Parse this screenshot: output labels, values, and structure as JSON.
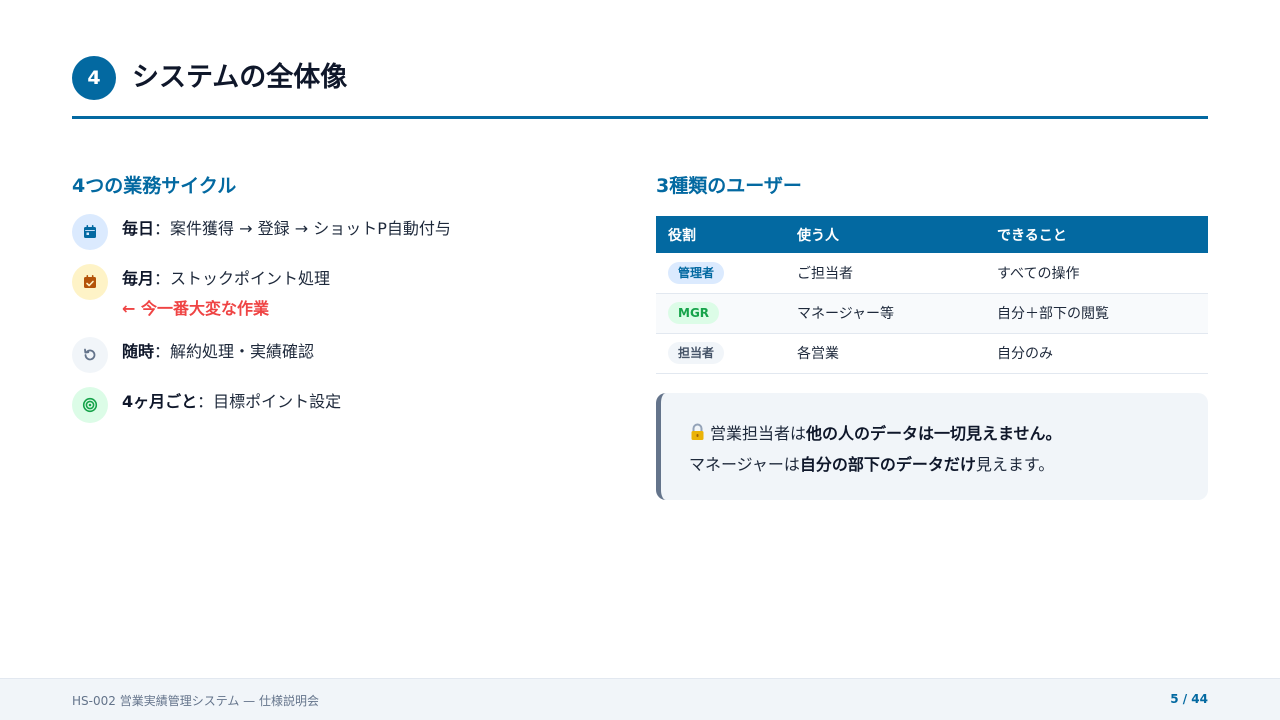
{
  "header": {
    "number": "4",
    "title": "システムの全体像"
  },
  "cycles": {
    "title": "4つの業務サイクル",
    "items": [
      {
        "icon": "calendar-icon",
        "label": "毎日",
        "sep": "：",
        "text": "案件獲得 → 登録 → ショットP自動付与"
      },
      {
        "icon": "calendar-check-icon",
        "label": "毎月",
        "sep": "：",
        "text": "ストックポイント処理",
        "note": "← 今一番大変な作業"
      },
      {
        "icon": "rotate-icon",
        "label": "随時",
        "sep": "：",
        "text": "解約処理・実績確認"
      },
      {
        "icon": "target-icon",
        "label": "4ヶ月ごと",
        "sep": "：",
        "text": "目標ポイント設定"
      }
    ]
  },
  "users": {
    "title": "3種類のユーザー",
    "headers": [
      "役割",
      "使う人",
      "できること"
    ],
    "rows": [
      {
        "role": "管理者",
        "who": "ご担当者",
        "can": "すべての操作"
      },
      {
        "role": "MGR",
        "who": "マネージャー等",
        "can": "自分＋部下の閲覧"
      },
      {
        "role": "担当者",
        "who": "各営業",
        "can": "自分のみ"
      }
    ]
  },
  "callout": {
    "icon": "lock-icon",
    "line1_pre": "営業担当者は",
    "line1_bold": "他の人のデータは一切見えません。",
    "line2_pre": "マネージャーは",
    "line2_bold": "自分の部下のデータだけ",
    "line2_post": "見えます。"
  },
  "footer": {
    "left": "HS-002 営業実績管理システム — 仕様説明会",
    "page": "5 / 44"
  },
  "colors": {
    "primary": "#0369a1",
    "alert": "#ef4444",
    "green": "#16a34a",
    "amber": "#b45309"
  }
}
